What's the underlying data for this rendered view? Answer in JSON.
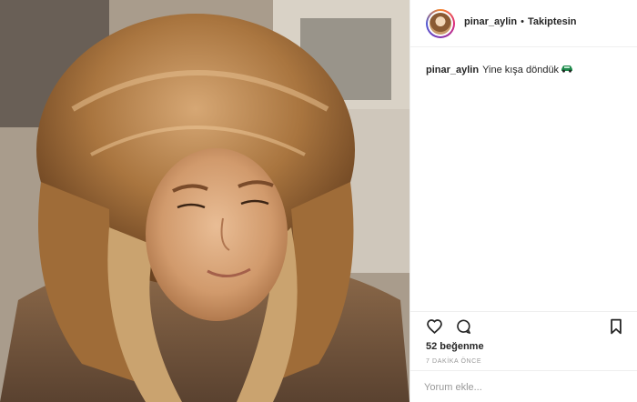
{
  "post": {
    "username": "pinar_aylin",
    "separator": "•",
    "follow_status": "Takiptesin",
    "caption_text": "Yine kışa döndük",
    "caption_emoji": "car-emoji",
    "likes": "52 beğenme",
    "timestamp": "7 DAKİKA ÖNCE",
    "comment_placeholder": "Yorum ekle..."
  },
  "icons": {
    "like": "heart-icon",
    "comment": "comment-icon",
    "save": "bookmark-icon"
  },
  "colors": {
    "text": "#262626",
    "muted": "#999999",
    "divider": "#efefef"
  }
}
